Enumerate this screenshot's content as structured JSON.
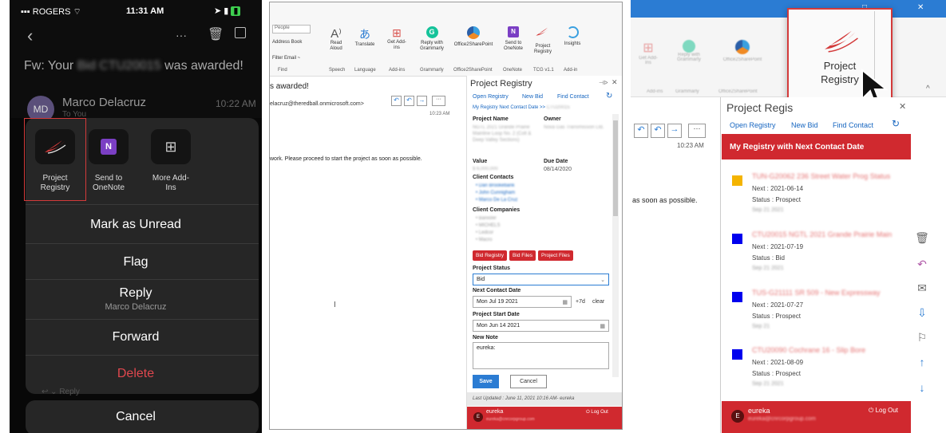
{
  "phone": {
    "carrier": "ROGERS",
    "time": "11:31 AM",
    "subject_prefix": "Fw: Your",
    "subject_blur": "Bid CTU20015",
    "subject_suffix": "was awarded!",
    "sender_initials": "MD",
    "sender": "Marco Delacruz",
    "sent_time": "10:22 AM",
    "to_line": "To You",
    "addins": [
      {
        "label": "Project Registry",
        "icon": "project-registry-logo"
      },
      {
        "label": "Send to OneNote",
        "icon": "onenote-icon"
      },
      {
        "label": "More Add-Ins",
        "icon": "add-ins-icon"
      }
    ],
    "actions": {
      "unread": "Mark as Unread",
      "flag": "Flag",
      "reply": "Reply",
      "reply_sub": "Marco Delacruz",
      "forward": "Forward",
      "delete": "Delete",
      "cancel": "Cancel",
      "reply_under": "Reply"
    },
    "colors": {
      "delete": "#e0474e",
      "highlight": "#d33a3a"
    }
  },
  "outlook": {
    "ribbon_left": [
      "People",
      "Address Book",
      "Filter Email ~"
    ],
    "ribbon_buttons": [
      {
        "label": "Read Aloud",
        "icon": "read-aloud-icon"
      },
      {
        "label": "Translate",
        "icon": "translate-icon"
      },
      {
        "label": "Get Add-ins",
        "icon": "get-addins-icon"
      },
      {
        "label": "Reply with Grammarly",
        "icon": "grammarly-icon"
      },
      {
        "label": "Office2SharePoint",
        "icon": "sharepoint-icon"
      },
      {
        "label": "Send to OneNote",
        "icon": "onenote-icon"
      },
      {
        "label": "Project Registry",
        "icon": "project-registry-logo"
      },
      {
        "label": "Insights",
        "icon": "insights-icon"
      }
    ],
    "ribbon_groups": [
      "Find",
      "Speech",
      "Language",
      "Add-ins",
      "Grammarly",
      "Office2SharePoint",
      "OneNote",
      "TCG v1.1",
      "Add-in"
    ],
    "mail_subject": "s awarded!",
    "mail_to": "elacruz@theredball.onmicrosoft.com>",
    "mail_time": "10:23 AM",
    "mail_body": "work. Please proceed to start the project as soon as possible.",
    "pane": {
      "title": "Project Registry",
      "nav": [
        "Open Registry",
        "New Bid",
        "Find Contact"
      ],
      "breadcrumb": "My Registry Next Contact Date  >>",
      "breadcrumb_blur": "CTU20015",
      "project_name_label": "Project Name",
      "project_name_value": "NGTL 2021 Grande Prairie Mainline Loop No. 2 (Colt & Deep Valley Sections)",
      "owner_label": "Owner",
      "owner_value": "Nova Gas Transmission Ltd.",
      "value_label": "Value",
      "value_value": "$ 6,000,000",
      "due_label": "Due Date",
      "due_value": "08/14/2020",
      "contacts_label": "Client Contacts",
      "contacts": [
        "Dan Brookebank",
        "John Cunnigham",
        "Marco De La Cruz"
      ],
      "companies_label": "Client Companies",
      "companies": [
        "Banister",
        "MICHELS",
        "Ledcor",
        "Macro"
      ],
      "buttons": [
        "Bid Registry",
        "Bid Files",
        "Project Files"
      ],
      "status_label": "Project Status",
      "status_value": "Bid",
      "next_label": "Next Contact Date",
      "next_value": "Mon Jul 19 2021",
      "plus7": "+7d",
      "clear": "clear",
      "start_label": "Project Start Date",
      "start_value": "Mon Jun 14 2021",
      "note_label": "New Note",
      "note_value": "eureka:",
      "save": "Save",
      "cancel": "Cancel",
      "updated": "Last Updated : June 11, 2021 10:16 AM- eureka",
      "user": "eureka",
      "user_email": "eureka@cnrcorpgroup.com",
      "logout": "Log Out"
    }
  },
  "zoom": {
    "title_bar_buttons": [
      "□",
      "✕"
    ],
    "ribbon_blurred": [
      "Get Add-ins",
      "Reply with Grammarly",
      "Office2SharePoint"
    ],
    "ribbon_groups_blurred": [
      "Add-ins",
      "Grammarly",
      "Office2SharePoint"
    ],
    "highlight_label": "Project Registry",
    "letter_e": "e",
    "pane_title": "Project Regis",
    "nav": [
      "Open Registry",
      "New Bid",
      "Find Contact"
    ],
    "mail_time": "10:23 AM",
    "mail_body": "as soon as possible.",
    "header": "My Registry with Next Contact Date",
    "items": [
      {
        "title": "TUN-G20062 236 Street Water Prog Status",
        "next": "Next : 2021-06-14",
        "status": "Status : Prospect",
        "sub": "Sep 21 2021",
        "color": "#f4b400"
      },
      {
        "title": "CTU20015 NGTL 2021 Grande Prairie Main",
        "next": "Next : 2021-07-19",
        "status": "Status : Bid",
        "sub": "Sep 21 2021",
        "color": "#0000ee"
      },
      {
        "title": "TUS-G21111 SR 509 - New Expressway",
        "next": "Next : 2021-07-27",
        "status": "Status : Prospect",
        "sub": "Sep 21",
        "color": "#0000ee"
      },
      {
        "title": "CTU20090 Cochrane 16 - Slip Bore",
        "next": "Next : 2021-08-09",
        "status": "Status : Prospect",
        "sub": "Sep 21 2021",
        "color": "#0000ee"
      }
    ],
    "user": "eureka",
    "user_email": "eureka@cnrcorpgroup.com",
    "logout": "Log Out",
    "header_color": "#d0292f"
  }
}
